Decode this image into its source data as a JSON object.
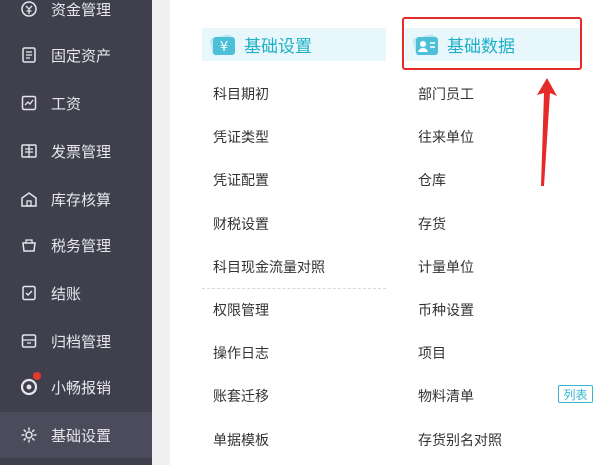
{
  "sidebar": {
    "items": [
      {
        "label": "资金管理",
        "icon": "money-icon"
      },
      {
        "label": "固定资产",
        "icon": "asset-icon"
      },
      {
        "label": "工资",
        "icon": "salary-icon"
      },
      {
        "label": "发票管理",
        "icon": "invoice-icon"
      },
      {
        "label": "库存核算",
        "icon": "warehouse-icon"
      },
      {
        "label": "税务管理",
        "icon": "tax-icon"
      },
      {
        "label": "结账",
        "icon": "checkout-icon"
      },
      {
        "label": "归档管理",
        "icon": "archive-icon"
      },
      {
        "label": "小畅报销",
        "icon": "reimburse-icon"
      },
      {
        "label": "基础设置",
        "icon": "gear-icon"
      }
    ]
  },
  "panel": {
    "basic_settings": {
      "title": "基础设置",
      "items": [
        "科目期初",
        "凭证类型",
        "凭证配置",
        "财税设置",
        "科目现金流量对照",
        "权限管理",
        "操作日志",
        "账套迁移",
        "单据模板"
      ]
    },
    "basic_data": {
      "title": "基础数据",
      "items": [
        "部门员工",
        "往来单位",
        "仓库",
        "存货",
        "计量单位",
        "币种设置",
        "项目",
        "物料清单",
        "存货别名对照"
      ],
      "tag": "列表"
    }
  },
  "colors": {
    "sidebar_bg": "#3f3f4e",
    "accent": "#1fb0c8",
    "annotation": "#e62a2a"
  }
}
